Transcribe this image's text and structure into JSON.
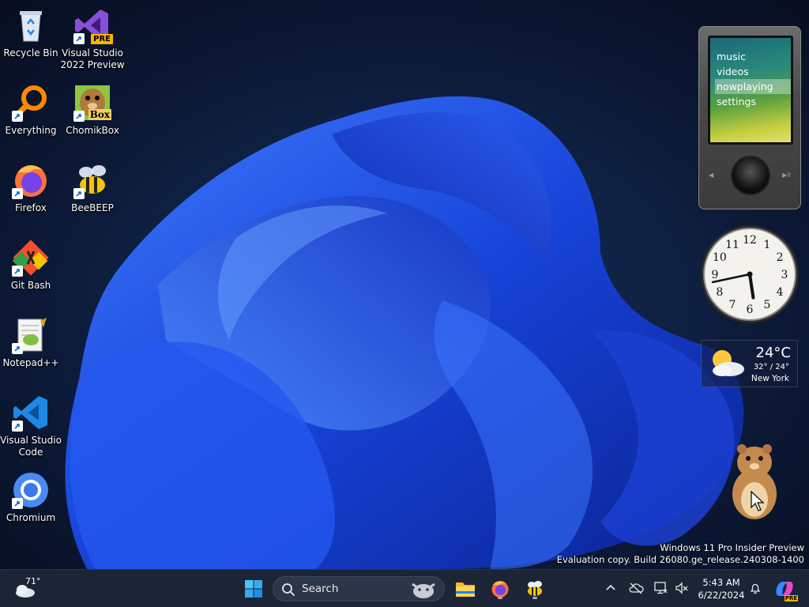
{
  "desktop": {
    "icons": [
      {
        "label": "Recycle Bin"
      },
      {
        "label": "Visual Studio\n2022 Preview"
      },
      {
        "label": "Everything"
      },
      {
        "label": "ChomikBox"
      },
      {
        "label": "Firefox"
      },
      {
        "label": "BeeBEEP"
      },
      {
        "label": "Git Bash"
      },
      {
        "label": "Notepad++"
      },
      {
        "label": "Visual Studio\nCode"
      },
      {
        "label": "Chromium"
      }
    ],
    "badges": {
      "vs_preview": "PRE",
      "chomik": "Box"
    }
  },
  "zune": {
    "menu": [
      "music",
      "videos",
      "nowplaying",
      "settings"
    ],
    "selected_index": 2
  },
  "clock_gadget": {
    "numbers": [
      "12",
      "1",
      "2",
      "3",
      "4",
      "5",
      "6",
      "7",
      "8",
      "9",
      "10",
      "11"
    ],
    "time": {
      "hours": 5,
      "minutes": 43
    }
  },
  "weather_gadget": {
    "temp": "24°C",
    "range": "32° / 24°",
    "city": "New York"
  },
  "watermark": {
    "line1": "Windows 11 Pro Insider Preview",
    "line2": "Evaluation copy. Build 26080.ge_release.240308-1400"
  },
  "taskbar": {
    "weather_temp": "71°",
    "search_label": "Search",
    "time": "5:43 AM",
    "date": "6/22/2024",
    "copilot_badge": "PRE"
  },
  "colors": {
    "taskbar": "#1c2536",
    "accent": "#0078d4"
  }
}
